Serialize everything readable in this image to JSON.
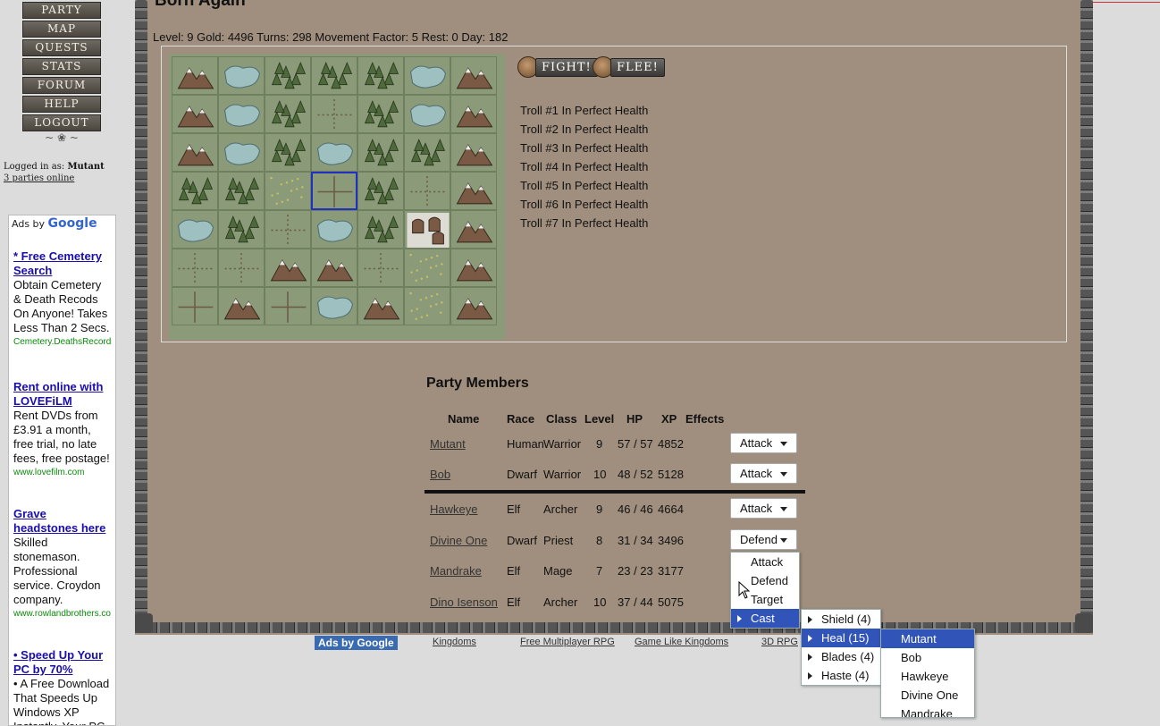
{
  "nav": {
    "items": [
      "PARTY",
      "MAP",
      "QUESTS",
      "STATS",
      "FORUM",
      "HELP",
      "LOGOUT"
    ],
    "flourish": "~ ❀ ~"
  },
  "login": {
    "label": "Logged in as:",
    "user": "Mutant",
    "online": "3 parties online"
  },
  "ads": {
    "header": "Ads by",
    "header_brand": "Google",
    "items": [
      {
        "title": "* Free Cemetery Search",
        "body": "Obtain Cemetery & Death Recods On Anyone! Takes Less Than 2 Secs.",
        "url": "Cemetery.DeathsRecords"
      },
      {
        "title": "Rent online with LOVEFiLM",
        "body": "Rent DVDs from £3.91 a month, free trial, no late fees, free postage!",
        "url": "www.lovefilm.com"
      },
      {
        "title": "Grave headstones here",
        "body": "Skilled stonemason. Professional service. Croydon company.",
        "url": "www.rowlandbrothers.co"
      },
      {
        "title": "• Speed Up Your PC by 70%",
        "body": "• A Free Download That Speeds Up Windows XP Instantly. Your PC",
        "url": ""
      }
    ]
  },
  "game": {
    "title": "Born Again",
    "status": "Level: 9 Gold: 4496 Turns: 298 Movement Factor: 5 Rest: 0 Day: 182",
    "fight_label": "FIGHT!",
    "flee_label": "FLEE!",
    "enemies": [
      "Troll #1 In Perfect Health",
      "Troll #2 In Perfect Health",
      "Troll #3 In Perfect Health",
      "Troll #4 In Perfect Health",
      "Troll #5 In Perfect Health",
      "Troll #6 In Perfect Health",
      "Troll #7 In Perfect Health"
    ],
    "map": [
      [
        "mountain",
        "water",
        "forest",
        "forest",
        "forest",
        "water",
        "mountain"
      ],
      [
        "mountain",
        "water",
        "forest",
        "plains",
        "forest",
        "water",
        "mountain"
      ],
      [
        "mountain",
        "water",
        "forest",
        "water",
        "forest",
        "forest",
        "mountain"
      ],
      [
        "forest",
        "forest",
        "grass",
        "road",
        "forest",
        "plains",
        "mountain"
      ],
      [
        "water",
        "forest",
        "plains",
        "water",
        "forest",
        "town",
        "mountain"
      ],
      [
        "plains",
        "plains",
        "mountain",
        "mountain",
        "plains",
        "grass",
        "mountain"
      ],
      [
        "road",
        "mountain",
        "road",
        "water",
        "mountain",
        "grass",
        "mountain"
      ]
    ]
  },
  "party": {
    "title": "Party Members",
    "headers": [
      "Name",
      "Race",
      "Class",
      "Level",
      "HP",
      "XP",
      "Effects"
    ],
    "members": [
      {
        "name": "Mutant",
        "race": "Human",
        "cls": "Warrior",
        "level": "9",
        "hp": "57 / 57",
        "xp": "4852",
        "action": "Attack"
      },
      {
        "name": "Bob",
        "race": "Dwarf",
        "cls": "Warrior",
        "level": "10",
        "hp": "48 / 52",
        "xp": "5128",
        "action": "Attack"
      },
      {
        "name": "Hawkeye",
        "race": "Elf",
        "cls": "Archer",
        "level": "9",
        "hp": "46 / 46",
        "xp": "4664",
        "action": "Attack"
      },
      {
        "name": "Divine One",
        "race": "Dwarf",
        "cls": "Priest",
        "level": "8",
        "hp": "31 / 34",
        "xp": "3496",
        "action": "Defend"
      },
      {
        "name": "Mandrake",
        "race": "Elf",
        "cls": "Mage",
        "level": "7",
        "hp": "23 / 23",
        "xp": "3177",
        "action": ""
      },
      {
        "name": "Dino Isenson",
        "race": "Elf",
        "cls": "Archer",
        "level": "10",
        "hp": "37 / 44",
        "xp": "5075",
        "action": ""
      }
    ]
  },
  "menus": {
    "action": [
      "Attack",
      "Defend",
      "Target",
      "Cast"
    ],
    "spells": [
      "Shield (4)",
      "Heal (15)",
      "Blades (4)",
      "Haste (4)"
    ],
    "targets": [
      "Mutant",
      "Bob",
      "Hawkeye",
      "Divine One",
      "Mandrake"
    ]
  },
  "footer": {
    "ads_label": "Ads by Google",
    "links": [
      "Kingdoms",
      "Free Multiplayer RPG",
      "Game Like Kingdoms",
      "3D RPG"
    ]
  },
  "colors": {
    "frame": "#a08f7e",
    "menu_highlight": "#3154b8",
    "nav": "#4a463f",
    "map": "#8b9a78"
  }
}
